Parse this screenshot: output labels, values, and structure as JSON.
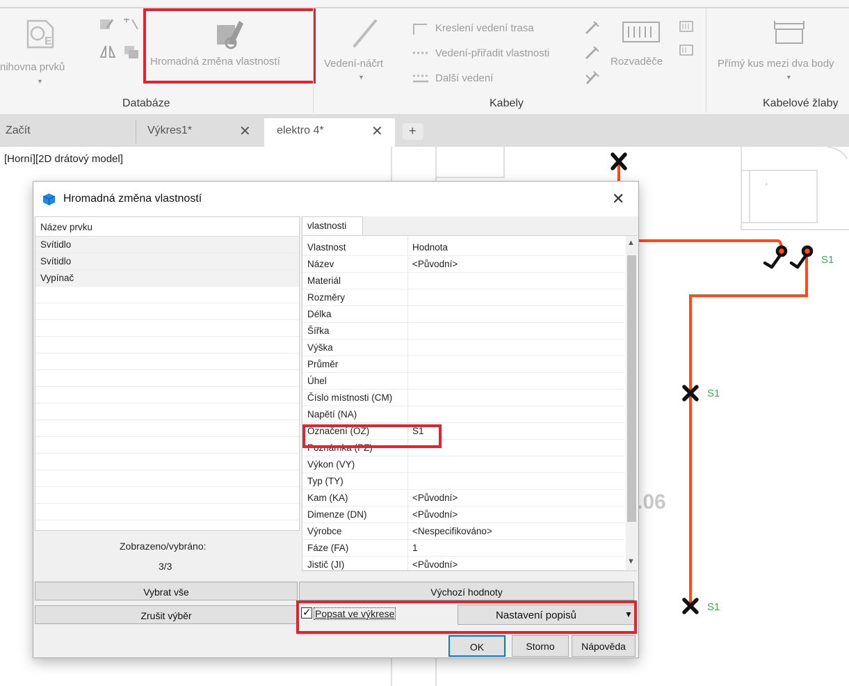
{
  "ribbon": {
    "library_label": "nihovna prvků",
    "mass_change_label": "Hromadná změna vlastností",
    "sketch_label": "Vedení-náčrt",
    "route_label": "Kreslení vedení trasa",
    "assign_props_label": "Vedení-přiřadit vlastnosti",
    "more_label": "Další vedení",
    "switchboard_label": "Rozvaděče",
    "straight_label": "Přímý kus mezi dva body",
    "group_database": "Databáze",
    "group_cables": "Kabely",
    "group_trays": "Kabelové žlaby"
  },
  "tabs": {
    "start": "Začít",
    "drawing1": "Výkres1*",
    "active": "elektro 4*",
    "add": "+",
    "close": "✕"
  },
  "viewport": {
    "label": "[Horní][2D drátový model]",
    "tag": "S1",
    "room_number": ".06"
  },
  "dialog": {
    "title": "Hromadná změna vlastností",
    "close": "✕",
    "list_header": "Název prvku",
    "items": [
      "Svítidlo",
      "Svítidlo",
      "Vypínač"
    ],
    "shown_label": "Zobrazeno/vybráno:",
    "shown_value": "3/3",
    "tab_label": "vlastnosti",
    "prop_header": "Vlastnost",
    "value_header": "Hodnota",
    "properties": [
      {
        "name": "Název",
        "value": "<Původní>"
      },
      {
        "name": "Materiál",
        "value": ""
      },
      {
        "name": "Rozměry",
        "value": ""
      },
      {
        "name": "Délka",
        "value": ""
      },
      {
        "name": "Šířka",
        "value": ""
      },
      {
        "name": "Výška",
        "value": ""
      },
      {
        "name": "Průměr",
        "value": ""
      },
      {
        "name": "Úhel",
        "value": ""
      },
      {
        "name": "Číslo místnosti (CM)",
        "value": ""
      },
      {
        "name": "Napětí (NA)",
        "value": ""
      },
      {
        "name": "Označení (OZ)",
        "value": "S1"
      },
      {
        "name": "Poznámka (PZ)",
        "value": ""
      },
      {
        "name": "Výkon (VY)",
        "value": ""
      },
      {
        "name": "Typ (TY)",
        "value": ""
      },
      {
        "name": "Kam (KA)",
        "value": "<Původní>"
      },
      {
        "name": "Dimenze (DN)",
        "value": "<Původní>"
      },
      {
        "name": "Výrobce",
        "value": "<Nespecifikováno>"
      },
      {
        "name": "Fáze (FA)",
        "value": "1"
      },
      {
        "name": "Jistič (JI)",
        "value": "<Původní>"
      }
    ],
    "select_all": "Vybrat vše",
    "deselect": "Zrušit výběr",
    "defaults": "Výchozí hodnoty",
    "annotate_checkbox": "Popsat ve výkrese",
    "annotate_checked": true,
    "label_settings": "Nastavení popisů",
    "ok": "OK",
    "cancel": "Storno",
    "help": "Nápověda"
  },
  "colors": {
    "highlight": "#e5232e",
    "cable": "#ff4a1c",
    "tag_text": "#2fb24a"
  }
}
